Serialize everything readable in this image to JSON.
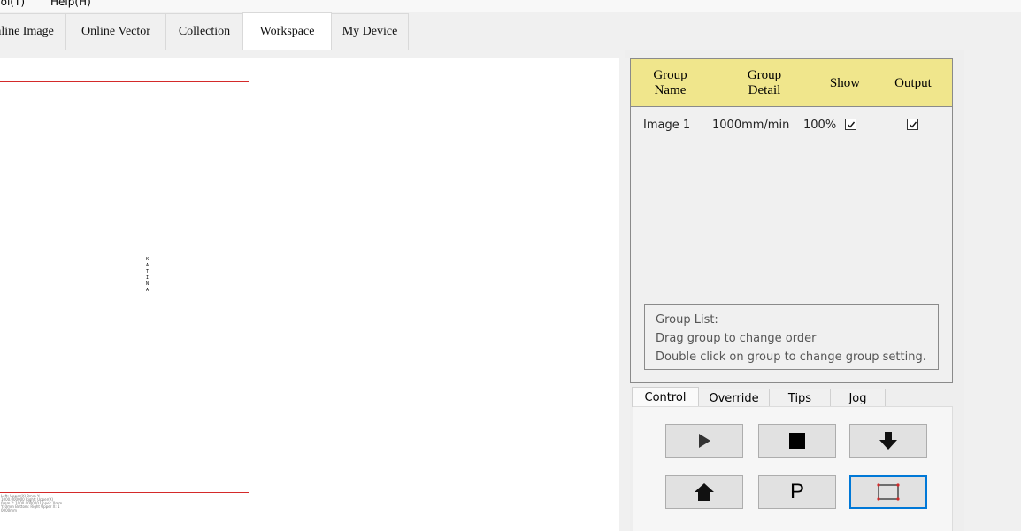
{
  "menu": {
    "tool": "Tool(T)",
    "help": "Help(H)"
  },
  "tabs": [
    {
      "label": "Online Image"
    },
    {
      "label": "Online Vector"
    },
    {
      "label": "Collection"
    },
    {
      "label": "Workspace",
      "active": true
    },
    {
      "label": "My Device"
    }
  ],
  "canvas": {
    "vertical_text": "K A T I N A",
    "corner_text": "Left: Upper(X) 0mm Y: 1000.000000 Right: Upper(X) 0mm Y: 1000.000000 Upper: 0mm Y: 0mm Bottom: Right Upper X: 1 0000mm"
  },
  "group_table": {
    "headers": {
      "name": "Group Name",
      "detail": "Group Detail",
      "show": "Show",
      "output": "Output"
    },
    "rows": [
      {
        "name": "Image 1",
        "detail": "1000mm/min",
        "power": "100%",
        "show": true,
        "output": true
      }
    ],
    "info": {
      "title": "Group List:",
      "line1": "Drag group to change order",
      "line2": "Double click on group to change group setting."
    }
  },
  "control_tabs": {
    "control": "Control",
    "override": "Override",
    "tips": "Tips",
    "jog": "Jog"
  },
  "control_buttons": {
    "play_icon": "play-icon",
    "stop_icon": "stop-icon",
    "download_icon": "arrow-down-icon",
    "home_icon": "home-icon",
    "pause_label": "P",
    "frame_icon": "frame-icon"
  },
  "colors": {
    "header_bg": "#f0e68c",
    "frame_red": "#d42a2a",
    "focus_blue": "#0078d7"
  }
}
